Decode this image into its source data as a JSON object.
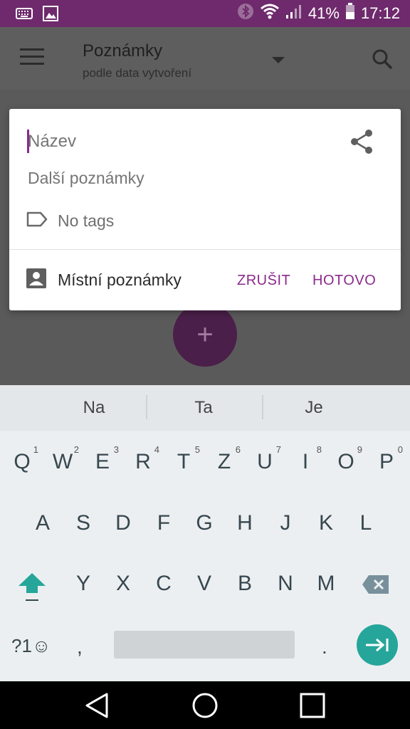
{
  "status_bar": {
    "battery": "41%",
    "time": "17:12",
    "icons": [
      "keyboard-icon",
      "image-icon",
      "bluetooth-icon",
      "wifi-icon",
      "signal-icon",
      "battery-icon"
    ]
  },
  "toolbar": {
    "title": "Poznámky",
    "subtitle": "podle data vytvoření"
  },
  "dialog": {
    "title_placeholder": "Název",
    "notes_placeholder": "Další poznámky",
    "tags_label": "No tags",
    "account_label": "Místní poznámky",
    "cancel_label": "ZRUŠIT",
    "done_label": "HOTOVO"
  },
  "fab": {
    "label": "+"
  },
  "keyboard": {
    "suggestions": [
      "Na",
      "Ta",
      "Je"
    ],
    "row1": [
      {
        "key": "Q",
        "num": "1"
      },
      {
        "key": "W",
        "num": "2"
      },
      {
        "key": "E",
        "num": "3"
      },
      {
        "key": "R",
        "num": "4"
      },
      {
        "key": "T",
        "num": "5"
      },
      {
        "key": "Z",
        "num": "6"
      },
      {
        "key": "U",
        "num": "7"
      },
      {
        "key": "I",
        "num": "8"
      },
      {
        "key": "O",
        "num": "9"
      },
      {
        "key": "P",
        "num": "0"
      }
    ],
    "row2": [
      "A",
      "S",
      "D",
      "F",
      "G",
      "H",
      "J",
      "K",
      "L"
    ],
    "row3": [
      "Y",
      "X",
      "C",
      "V",
      "B",
      "N",
      "M"
    ],
    "symbols_label": "?1☺",
    "comma": ",",
    "period": ".",
    "accent_color": "#26a69a"
  },
  "colors": {
    "status_bar": "#6e2a6c",
    "accent": "#8b2a8a"
  }
}
